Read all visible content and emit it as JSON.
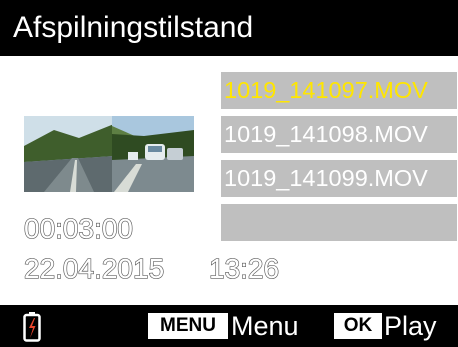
{
  "header": {
    "title": "Afspilningstilstand"
  },
  "files": {
    "items": [
      {
        "name": "1019_141097.MOV"
      },
      {
        "name": "1019_141098.MOV"
      },
      {
        "name": "1019_141099.MOV"
      },
      {
        "name": ""
      }
    ],
    "selected_index": 0,
    "selected_color": "#ffe600"
  },
  "info": {
    "duration": "00:03:00",
    "date": "22.04.2015",
    "time": "13:26"
  },
  "footer": {
    "battery_icon": "battery-low-icon",
    "battery_color": "#e8452c",
    "menu_key": "MENU",
    "menu_label": "Menu",
    "ok_key": "OK",
    "ok_label": "Play"
  }
}
